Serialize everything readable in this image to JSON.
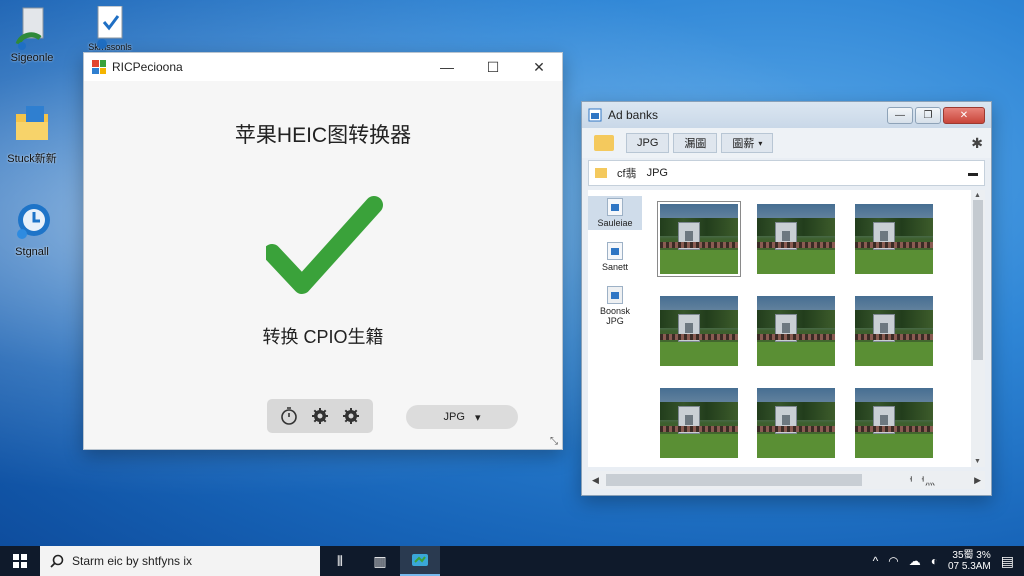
{
  "desktop": {
    "icons": [
      {
        "label": "Sigeonle",
        "icon": "recycle-bin-icon"
      },
      {
        "label": "Skmssonls",
        "icon": "document-icon"
      },
      {
        "label": "Stuck新新",
        "icon": "folder-icon"
      },
      {
        "label": "Stgnall",
        "icon": "edge-browser-icon"
      }
    ]
  },
  "converter": {
    "title": "RICPecioona",
    "heading": "苹果HEIC图转换器",
    "status": "转换 CPIO生籍",
    "format_value": "JPG",
    "toolbar_icons": [
      "timer-icon",
      "gear-icon",
      "gear-icon"
    ],
    "colors": {
      "check": "#3aa23a"
    }
  },
  "explorer": {
    "title": "Ad banks",
    "ribbon_tabs": [
      "JPG",
      "漏圖",
      "圖薪"
    ],
    "address": {
      "parent": "cf翡",
      "current": "JPG"
    },
    "nav_items": [
      {
        "label": "Sauleiae",
        "icon": "picture-folder-icon"
      },
      {
        "label": "Sanett",
        "icon": "picture-folder-icon"
      },
      {
        "label": "Boonsk\nJPG",
        "icon": "document-folder-icon"
      }
    ],
    "thumbnails": 9,
    "hscroll_label": "ᅥ ᅥ灬"
  },
  "taskbar": {
    "search_placeholder": "Starm eic by shtfyns ix",
    "clock_time": "35蜀 3%",
    "clock_date": "07 5.3AM",
    "tray_icons": [
      "chevron-up-icon",
      "wifi-icon",
      "cloud-icon",
      "volume-icon",
      "network-icon"
    ]
  }
}
